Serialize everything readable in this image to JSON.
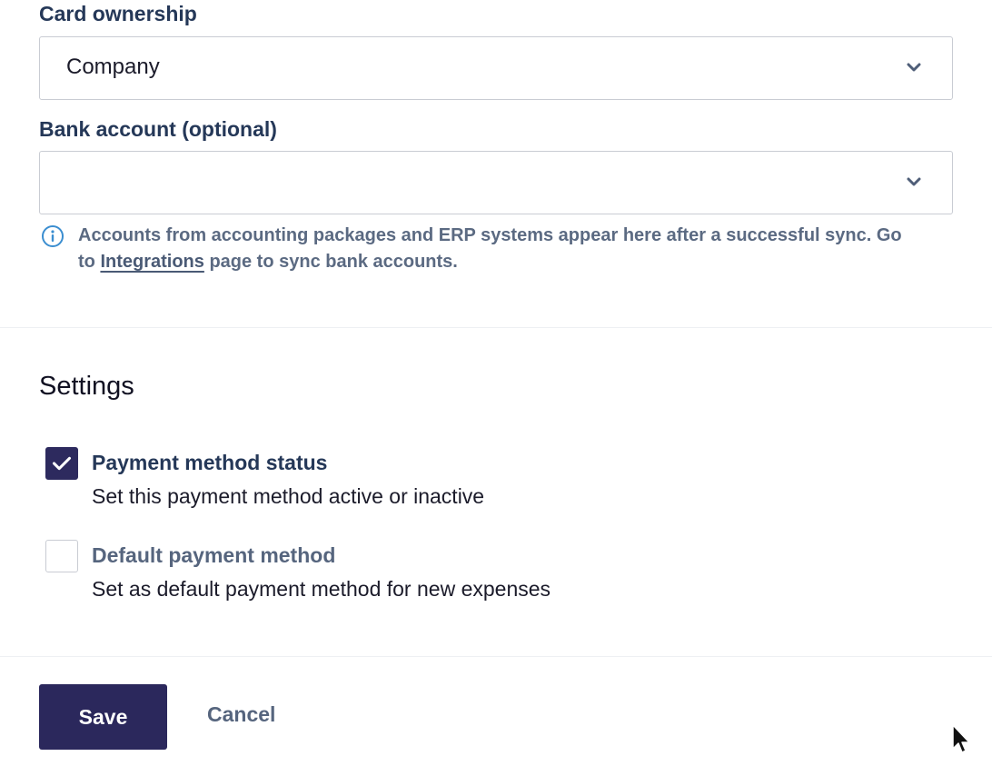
{
  "card_ownership": {
    "label": "Card ownership",
    "value": "Company",
    "chevron_icon": "chevron-down-icon"
  },
  "bank_account": {
    "label": "Bank account (optional)",
    "value": "",
    "chevron_icon": "chevron-down-icon"
  },
  "info_note": {
    "icon": "info-icon",
    "text_before": "Accounts from accounting packages and ERP systems appear here after a successful sync. Go to ",
    "link_text": "Integrations",
    "text_after": " page to sync bank accounts."
  },
  "settings": {
    "title": "Settings",
    "options": [
      {
        "title": "Payment method status",
        "description": "Set this payment method active or inactive",
        "checked": true
      },
      {
        "title": "Default payment method",
        "description": "Set as default payment method for new expenses",
        "checked": false
      }
    ]
  },
  "actions": {
    "save_label": "Save",
    "cancel_label": "Cancel"
  },
  "colors": {
    "primary": "#2b285c",
    "heading": "#253858",
    "info": "#3b8ed0"
  }
}
